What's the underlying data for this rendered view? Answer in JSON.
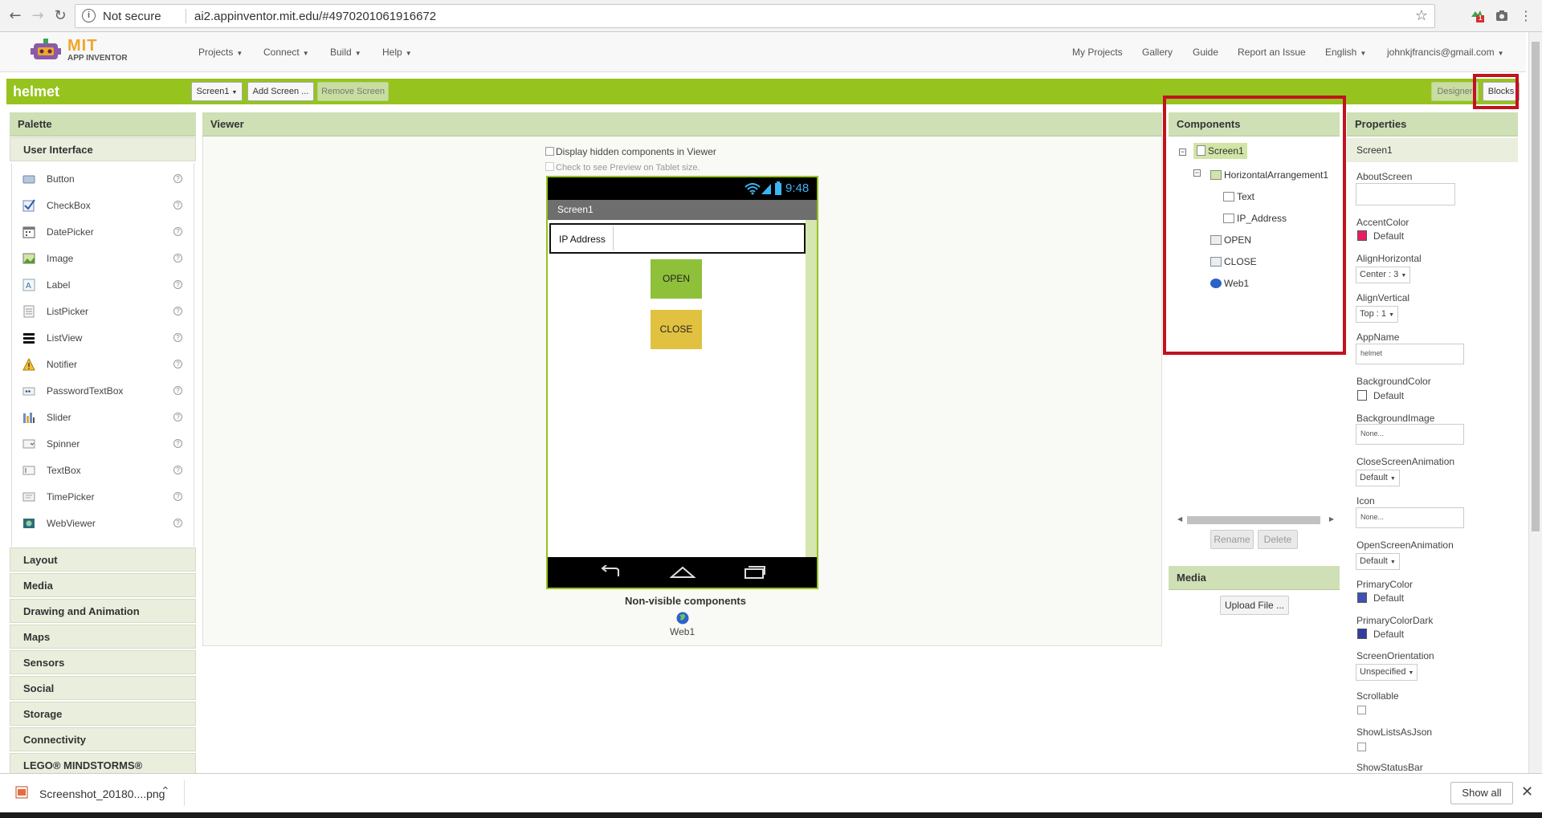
{
  "browser": {
    "security_label": "Not secure",
    "url": "ai2.appinventor.mit.edu/#4970201061916672",
    "extension_badge": "1"
  },
  "app": {
    "logo_text": "MIT",
    "logo_subtext": "APP INVENTOR",
    "menu": [
      {
        "label": "Projects"
      },
      {
        "label": "Connect"
      },
      {
        "label": "Build"
      },
      {
        "label": "Help"
      }
    ],
    "right_links": {
      "my_projects": "My Projects",
      "gallery": "Gallery",
      "guide": "Guide",
      "report": "Report an Issue",
      "language": "English",
      "account": "johnkjfrancis@gmail.com"
    }
  },
  "toolbar": {
    "project_name": "helmet",
    "screen_select": "Screen1",
    "add_screen": "Add Screen ...",
    "remove_screen": "Remove Screen",
    "designer": "Designer",
    "blocks": "Blocks"
  },
  "palette": {
    "title": "Palette",
    "open_category": "User Interface",
    "items": [
      {
        "label": "Button"
      },
      {
        "label": "CheckBox"
      },
      {
        "label": "DatePicker"
      },
      {
        "label": "Image"
      },
      {
        "label": "Label"
      },
      {
        "label": "ListPicker"
      },
      {
        "label": "ListView"
      },
      {
        "label": "Notifier"
      },
      {
        "label": "PasswordTextBox"
      },
      {
        "label": "Slider"
      },
      {
        "label": "Spinner"
      },
      {
        "label": "TextBox"
      },
      {
        "label": "TimePicker"
      },
      {
        "label": "WebViewer"
      }
    ],
    "help_glyph": "?",
    "categories": [
      "Layout",
      "Media",
      "Drawing and Animation",
      "Maps",
      "Sensors",
      "Social",
      "Storage",
      "Connectivity",
      "LEGO® MINDSTORMS®"
    ]
  },
  "viewer": {
    "title": "Viewer",
    "hidden_toggle": "Display hidden components in Viewer",
    "tablet_toggle": "Check to see Preview on Tablet size.",
    "phone": {
      "time": "9:48",
      "screen_title": "Screen1",
      "ip_label": "IP Address",
      "open_label": "OPEN",
      "close_label": "CLOSE"
    },
    "nonvisible_title": "Non-visible components",
    "nonvisible_item": "Web1"
  },
  "components": {
    "title": "Components",
    "tree": {
      "screen": "Screen1",
      "arrangement": "HorizontalArrangement1",
      "text": "Text",
      "ip": "IP_Address",
      "open": "OPEN",
      "close": "CLOSE",
      "web": "Web1"
    },
    "rename": "Rename",
    "delete": "Delete"
  },
  "media": {
    "title": "Media",
    "upload": "Upload File ..."
  },
  "properties": {
    "title": "Properties",
    "component": "Screen1",
    "about_screen": "AboutScreen",
    "accent_color": "AccentColor",
    "accent_value": "Default",
    "align_h": "AlignHorizontal",
    "align_h_value": "Center : 3",
    "align_v": "AlignVertical",
    "align_v_value": "Top : 1",
    "app_name": "AppName",
    "app_name_value": "helmet",
    "bg_color": "BackgroundColor",
    "bg_color_value": "Default",
    "bg_image": "BackgroundImage",
    "bg_image_value": "None...",
    "close_anim": "CloseScreenAnimation",
    "close_anim_value": "Default",
    "icon": "Icon",
    "icon_value": "None...",
    "open_anim": "OpenScreenAnimation",
    "open_anim_value": "Default",
    "primary_color": "PrimaryColor",
    "primary_color_value": "Default",
    "primary_dark": "PrimaryColorDark",
    "primary_dark_value": "Default",
    "orientation": "ScreenOrientation",
    "orientation_value": "Unspecified",
    "scrollable": "Scrollable",
    "show_lists": "ShowListsAsJson",
    "show_status": "ShowStatusBar",
    "colors": {
      "accent": "#e91e63",
      "background": "#ffffff",
      "primary": "#3f51b5",
      "primary_dark": "#303f9f"
    }
  },
  "download": {
    "file": "Screenshot_20180....png",
    "show_all": "Show all"
  },
  "theme": {
    "green": "#96c31e",
    "highlight": "#c1121f",
    "open_button": "#8fc03a",
    "close_button": "#e1c140"
  }
}
